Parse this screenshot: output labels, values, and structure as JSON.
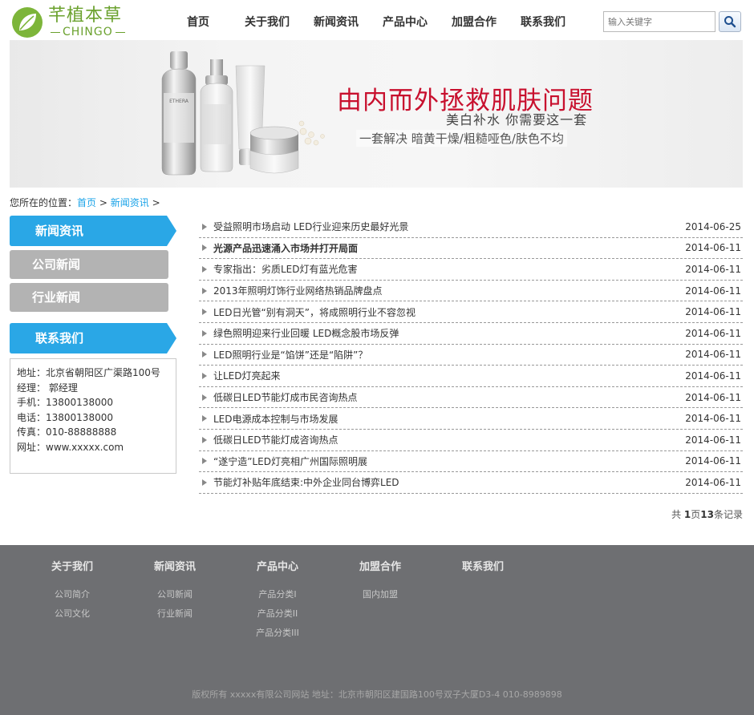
{
  "logo": {
    "cn": "芊植本草",
    "en": "CHINGO"
  },
  "nav": [
    "首页",
    "关于我们",
    "新闻资讯",
    "产品中心",
    "加盟合作",
    "联系我们"
  ],
  "search": {
    "placeholder": "输入关键字"
  },
  "banner": {
    "headline": "由内而外拯救肌肤问题",
    "subline": "美白补水  你需要这一套",
    "tagline": "一套解决 暗黄干燥/粗糙哑色/肤色不均",
    "product_brand": "ETHERA"
  },
  "breadcrumb": {
    "prefix": "您所在的位置：",
    "home": "首页",
    "sep": ">",
    "current": "新闻资讯"
  },
  "sidebar": {
    "news_head": "新闻资讯",
    "items": [
      "公司新闻",
      "行业新闻"
    ],
    "contact_head": "联系我们",
    "contact": [
      "地址：北京省朝阳区广渠路100号",
      "经理：  郭经理",
      "手机：13800138000",
      "电话：13800138000",
      "传真：010-88888888",
      "网址：www.xxxxx.com"
    ]
  },
  "news": [
    {
      "title": "受益照明市场启动 LED行业迎来历史最好光景",
      "date": "2014-06-25"
    },
    {
      "title": "光源产品迅速涌入市场并打开局面",
      "date": "2014-06-11",
      "bold": true
    },
    {
      "title": "专家指出：劣质LED灯有蓝光危害",
      "date": "2014-06-11"
    },
    {
      "title": "2013年照明灯饰行业网络热销品牌盘点",
      "date": "2014-06-11"
    },
    {
      "title": "LED日光管“别有洞天”，将成照明行业不容忽视",
      "date": "2014-06-11"
    },
    {
      "title": "绿色照明迎来行业回暖 LED概念股市场反弹",
      "date": "2014-06-11"
    },
    {
      "title": "LED照明行业是“馅饼”还是“陷阱”？",
      "date": "2014-06-11"
    },
    {
      "title": "让LED灯亮起来",
      "date": "2014-06-11"
    },
    {
      "title": "低碳日LED节能灯成市民咨询热点",
      "date": "2014-06-11"
    },
    {
      "title": "LED电源成本控制与市场发展",
      "date": "2014-06-11"
    },
    {
      "title": "低碳日LED节能灯成咨询热点",
      "date": "2014-06-11"
    },
    {
      "title": "“遂宁造”LED灯亮相广州国际照明展",
      "date": "2014-06-11"
    },
    {
      "title": "节能灯补贴年底结束:中外企业同台博弈LED",
      "date": "2014-06-11"
    }
  ],
  "pager": {
    "prefix": "共 ",
    "pages": "1",
    "pages_unit": "页",
    "records": "13",
    "records_unit": "条记录"
  },
  "footer": {
    "columns": [
      {
        "title": "关于我们",
        "links": [
          "公司简介",
          "公司文化"
        ]
      },
      {
        "title": "新闻资讯",
        "links": [
          "公司新闻",
          "行业新闻"
        ]
      },
      {
        "title": "产品中心",
        "links": [
          "产品分类I",
          "产品分类II",
          "产品分类III"
        ]
      },
      {
        "title": "加盟合作",
        "links": [
          "国内加盟"
        ]
      },
      {
        "title": "联系我们",
        "links": []
      }
    ],
    "copyright": "版权所有 xxxxx有限公司网站 地址：北京市朝阳区建国路100号双子大厦D3-4 010-8989898"
  },
  "colors": {
    "accent": "#2aa7e6",
    "brand_green": "#6aa12d",
    "headline_red": "#c8102e",
    "footer_bg": "#6e6f72"
  }
}
